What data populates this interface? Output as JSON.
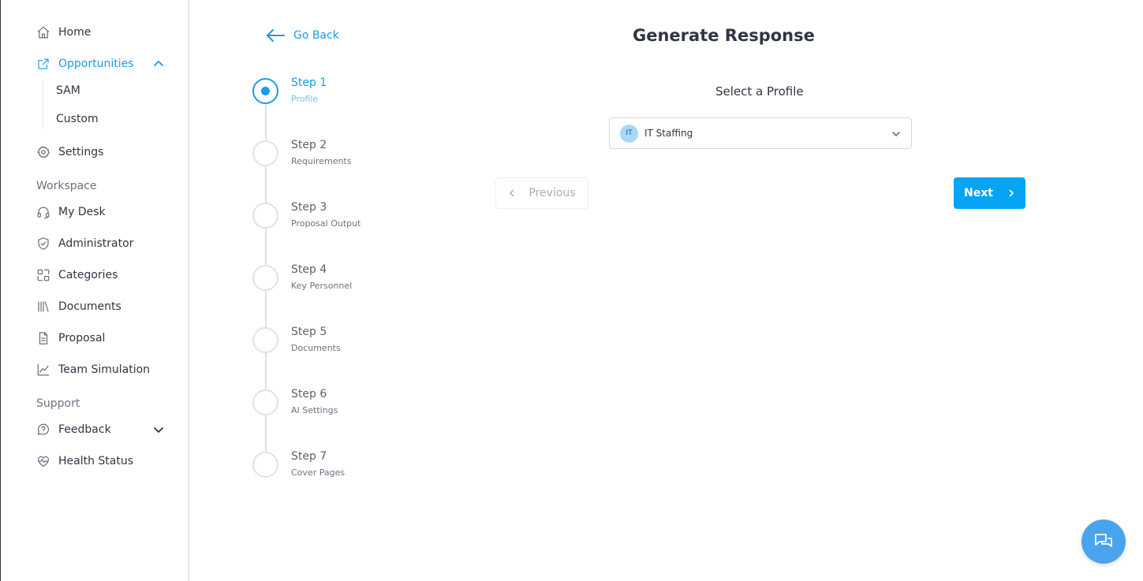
{
  "sidebar": {
    "home": "Home",
    "opportunities": "Opportunities",
    "opportunities_sub": [
      "SAM",
      "Custom"
    ],
    "settings": "Settings",
    "workspace_label": "Workspace",
    "my_desk": "My Desk",
    "administrator": "Administrator",
    "categories": "Categories",
    "documents": "Documents",
    "proposal": "Proposal",
    "team_simulation": "Team Simulation",
    "support_label": "Support",
    "feedback": "Feedback",
    "health_status": "Health Status"
  },
  "header": {
    "go_back": "Go Back",
    "title": "Generate Response"
  },
  "steps": [
    {
      "title": "Step 1",
      "subtitle": "Profile"
    },
    {
      "title": "Step 2",
      "subtitle": "Requirements"
    },
    {
      "title": "Step 3",
      "subtitle": "Proposal Output"
    },
    {
      "title": "Step 4",
      "subtitle": "Key Personnel"
    },
    {
      "title": "Step 5",
      "subtitle": "Documents"
    },
    {
      "title": "Step 6",
      "subtitle": "AI Settings"
    },
    {
      "title": "Step 7",
      "subtitle": "Cover Pages"
    }
  ],
  "current_step": 1,
  "profile": {
    "label": "Select a Profile",
    "avatar": "IT",
    "selected": "IT Staffing"
  },
  "buttons": {
    "previous": "Previous",
    "next": "Next"
  },
  "colors": {
    "accent": "#1a9be6",
    "next_button": "#05a4f4",
    "chat_button": "#4aa3ee"
  },
  "icons": {
    "home": "home-icon",
    "opportunities": "external-link-icon",
    "settings": "gear-icon",
    "my_desk": "headset-icon",
    "administrator": "shield-check-icon",
    "categories": "categories-icon",
    "documents": "library-icon",
    "proposal": "file-text-icon",
    "team_simulation": "line-chart-icon",
    "feedback": "message-help-icon",
    "health_status": "heart-pulse-icon",
    "chat": "chat-icon"
  }
}
